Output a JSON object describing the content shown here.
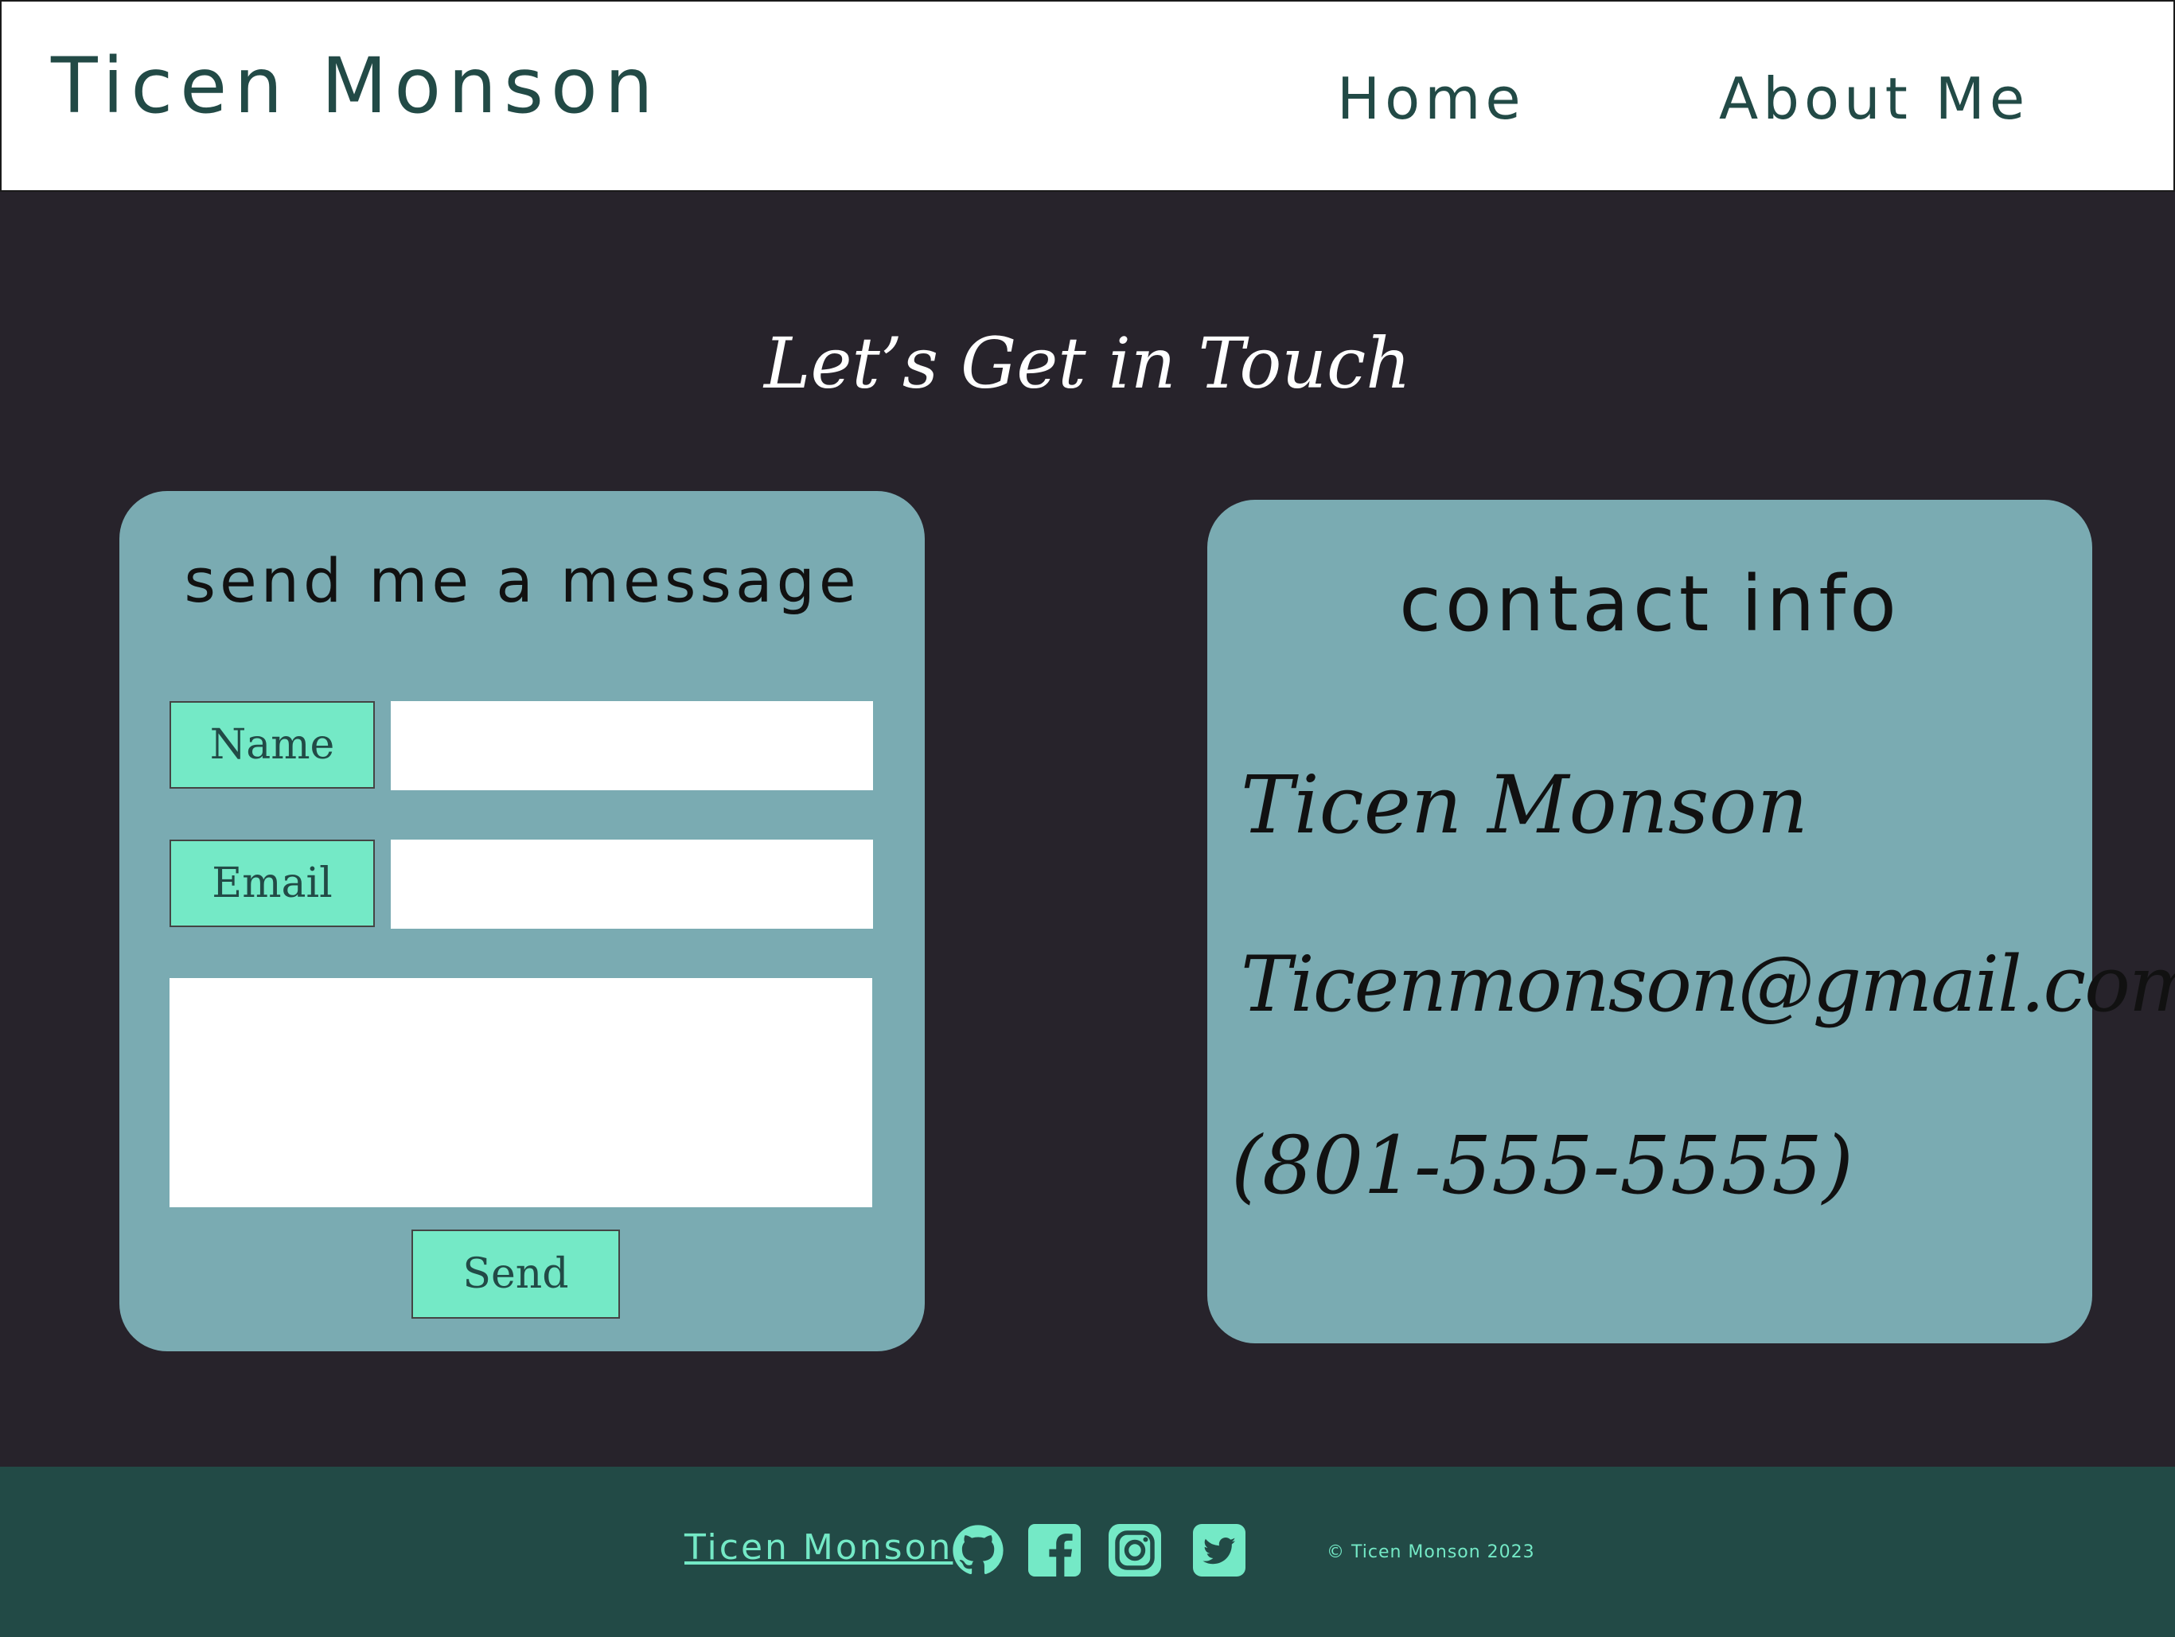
{
  "header": {
    "brand": "Ticen Monson",
    "nav": [
      {
        "label": "Home"
      },
      {
        "label": "About Me"
      }
    ]
  },
  "main": {
    "title": "Let’s Get in Touch",
    "message_card": {
      "title": "send me a message",
      "name_label": "Name",
      "email_label": "Email",
      "name_value": "",
      "email_value": "",
      "message_value": "",
      "send_label": "Send"
    },
    "contact_card": {
      "title": "contact info",
      "name": "Ticen Monson",
      "email": "Ticenmonson@gmail.com",
      "phone": "(801-555-5555)"
    }
  },
  "footer": {
    "name_link": "Ticen Monson",
    "socials": [
      {
        "icon": "github-icon"
      },
      {
        "icon": "facebook-icon"
      },
      {
        "icon": "instagram-icon"
      },
      {
        "icon": "twitter-icon"
      }
    ],
    "copyright": "© Ticen Monson 2023"
  },
  "colors": {
    "page_bg": "#27232b",
    "header_bg": "#ffffff",
    "brand_text": "#224a46",
    "card_bg": "#7aabb2",
    "accent": "#74e9c6",
    "footer_bg": "#224a46"
  }
}
